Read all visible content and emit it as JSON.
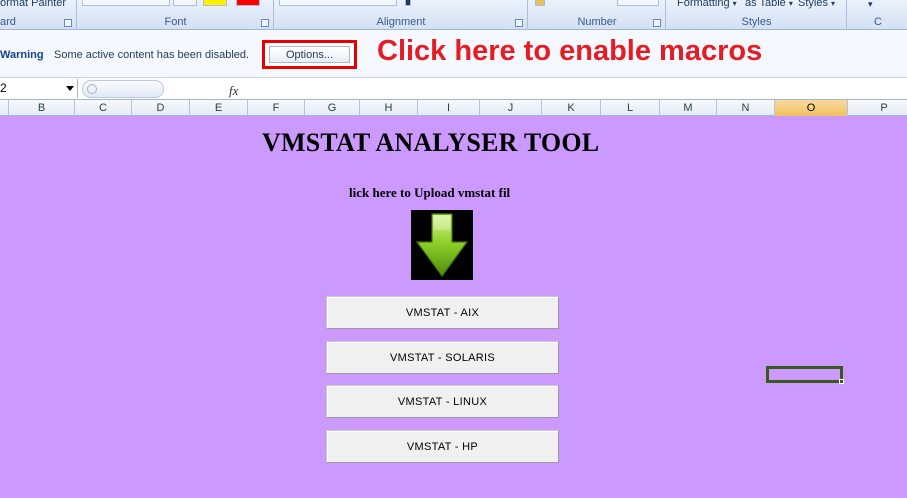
{
  "ribbon": {
    "clipboard_format_painter": "ormat Painter",
    "clipboard_label": "ard",
    "font_label": "Font",
    "alignment_label": "Alignment",
    "number_label": "Number",
    "styles_formatting": "Formatting",
    "styles_as_table": "as Table",
    "styles_styles": "Styles",
    "styles_label": "Styles",
    "cells_label": "C"
  },
  "security_bar": {
    "warning_title": "Warning",
    "warning_text": "Some active content has been disabled.",
    "options_label": "Options...",
    "annotation": "Click here to enable macros",
    "annotation_color": "#e61c24"
  },
  "formula_bar": {
    "name_box": "2",
    "fx_icon": "fx-icon",
    "formula_value": ""
  },
  "columns": [
    {
      "label": "B",
      "selected": false
    },
    {
      "label": "C",
      "selected": false
    },
    {
      "label": "D",
      "selected": false
    },
    {
      "label": "E",
      "selected": false
    },
    {
      "label": "F",
      "selected": false
    },
    {
      "label": "G",
      "selected": false
    },
    {
      "label": "H",
      "selected": false
    },
    {
      "label": "I",
      "selected": false
    },
    {
      "label": "J",
      "selected": false
    },
    {
      "label": "K",
      "selected": false
    },
    {
      "label": "L",
      "selected": false
    },
    {
      "label": "M",
      "selected": false
    },
    {
      "label": "N",
      "selected": false
    },
    {
      "label": "O",
      "selected": true
    },
    {
      "label": "P",
      "selected": false
    }
  ],
  "sheet": {
    "background_color": "#cc99ff",
    "title": "VMSTAT ANALYSER TOOL",
    "upload_label": "lick here to Upload vmstat fil",
    "upload_icon": "download-arrow-icon",
    "buttons": [
      {
        "id": "aix",
        "label": "VMSTAT - AIX"
      },
      {
        "id": "solaris",
        "label": "VMSTAT - SOLARIS"
      },
      {
        "id": "linux",
        "label": "VMSTAT - LINUX"
      },
      {
        "id": "hp",
        "label": "VMSTAT - HP"
      }
    ]
  }
}
